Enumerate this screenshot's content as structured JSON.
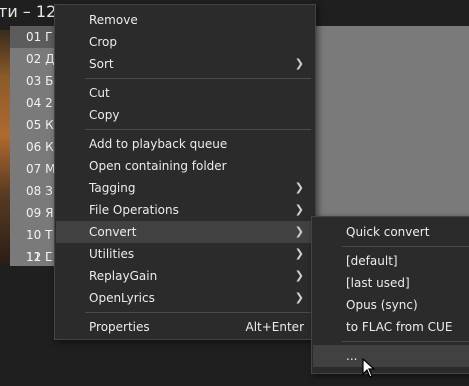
{
  "window": {
    "title": "ти – 12"
  },
  "playlist": {
    "rows": [
      "01 Г",
      "02 Д",
      "03 Б",
      "04 2",
      "05 К",
      "06 К",
      "07 М",
      "08 З",
      "09 Я",
      "10 Т",
      "11 Г",
      "12 L"
    ]
  },
  "context_menu": {
    "items": [
      {
        "label": "Remove"
      },
      {
        "label": "Crop"
      },
      {
        "label": "Sort",
        "submenu": true
      },
      {
        "label": "Cut"
      },
      {
        "label": "Copy"
      },
      {
        "label": "Add to playback queue"
      },
      {
        "label": "Open containing folder"
      },
      {
        "label": "Tagging",
        "submenu": true
      },
      {
        "label": "File Operations",
        "submenu": true
      },
      {
        "label": "Convert",
        "submenu": true,
        "highlighted": true
      },
      {
        "label": "Utilities",
        "submenu": true
      },
      {
        "label": "ReplayGain",
        "submenu": true
      },
      {
        "label": "OpenLyrics",
        "submenu": true
      },
      {
        "label": "Properties",
        "shortcut": "Alt+Enter"
      }
    ]
  },
  "convert_submenu": {
    "items": [
      {
        "label": "Quick convert"
      },
      {
        "label": "[default]"
      },
      {
        "label": "[last used]"
      },
      {
        "label": "Opus (sync)"
      },
      {
        "label": "to FLAC from CUE"
      },
      {
        "label": "...",
        "highlighted": true
      }
    ]
  },
  "icons": {
    "submenu_arrow": "chevron-right-icon",
    "cursor": "mouse-pointer-icon"
  }
}
